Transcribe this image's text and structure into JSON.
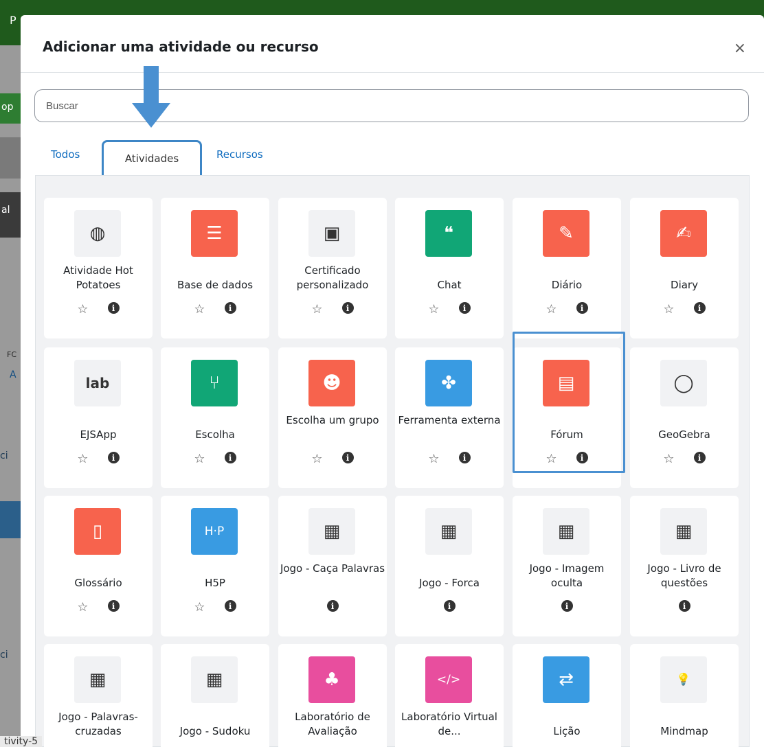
{
  "background": {
    "top_letter": "P",
    "fragments": [
      "op",
      "al",
      "FC",
      "A",
      "ci",
      "ci"
    ],
    "footer_tag": "tivity-5"
  },
  "modal": {
    "title": "Adicionar uma atividade ou recurso",
    "close": "×"
  },
  "search": {
    "placeholder": "Buscar"
  },
  "tabs": [
    {
      "label": "Todos"
    },
    {
      "label": "Atividades"
    },
    {
      "label": "Recursos"
    }
  ],
  "cards": [
    {
      "name": "Atividade Hot Potatoes",
      "icon": "hot-potatoes-icon",
      "color": "#f1f2f4",
      "star": true
    },
    {
      "name": "Base de dados",
      "icon": "database-icon",
      "color": "#f7634d",
      "star": true
    },
    {
      "name": "Certificado personalizado",
      "icon": "certificate-icon",
      "color": "#f1f2f4",
      "star": true
    },
    {
      "name": "Chat",
      "icon": "chat-icon",
      "color": "#11a676",
      "star": true
    },
    {
      "name": "Diário",
      "icon": "journal-edit-icon",
      "color": "#f7634d",
      "star": true
    },
    {
      "name": "Diary",
      "icon": "diary-icon",
      "color": "#f7634d",
      "star": true
    },
    {
      "name": "EJSApp",
      "icon": "lab-icon",
      "color": "#f1f2f4",
      "star": true
    },
    {
      "name": "Escolha",
      "icon": "choice-icon",
      "color": "#11a676",
      "star": true
    },
    {
      "name": "Escolha um grupo",
      "icon": "group-icon",
      "color": "#f7634d",
      "star": true
    },
    {
      "name": "Ferramenta externa",
      "icon": "puzzle-icon",
      "color": "#399be2",
      "star": true
    },
    {
      "name": "Fórum",
      "icon": "forum-icon",
      "color": "#f7634d",
      "star": true
    },
    {
      "name": "GeoGebra",
      "icon": "geogebra-icon",
      "color": "#f1f2f4",
      "star": true
    },
    {
      "name": "Glossário",
      "icon": "glossary-icon",
      "color": "#f7634d",
      "star": true
    },
    {
      "name": "H5P",
      "icon": "h5p-icon",
      "color": "#399be2",
      "star": true
    },
    {
      "name": "Jogo - Caça Palavras",
      "icon": "game-grid-icon",
      "color": "#f1f2f4",
      "star": false
    },
    {
      "name": "Jogo - Forca",
      "icon": "game-grid-icon",
      "color": "#f1f2f4",
      "star": false
    },
    {
      "name": "Jogo - Imagem oculta",
      "icon": "game-grid-icon",
      "color": "#f1f2f4",
      "star": false
    },
    {
      "name": "Jogo - Livro de questões",
      "icon": "game-grid-icon",
      "color": "#f1f2f4",
      "star": false
    },
    {
      "name": "Jogo - Palavras-cruzadas",
      "icon": "game-grid-icon",
      "color": "#f1f2f4",
      "star": false
    },
    {
      "name": "Jogo - Sudoku",
      "icon": "game-grid-icon",
      "color": "#f1f2f4",
      "star": false
    },
    {
      "name": "Laboratório de Avaliação",
      "icon": "workshop-icon",
      "color": "#e84e9e",
      "star": true
    },
    {
      "name": "Laboratório Virtual de...",
      "icon": "vpl-icon",
      "color": "#e84e9e",
      "star": true
    },
    {
      "name": "Lição",
      "icon": "lesson-icon",
      "color": "#399be2",
      "star": true
    },
    {
      "name": "Mindmap",
      "icon": "lightbulb-icon",
      "color": "#f1f2f4",
      "star": true
    }
  ],
  "info_glyph": "i",
  "star_glyph": "☆"
}
